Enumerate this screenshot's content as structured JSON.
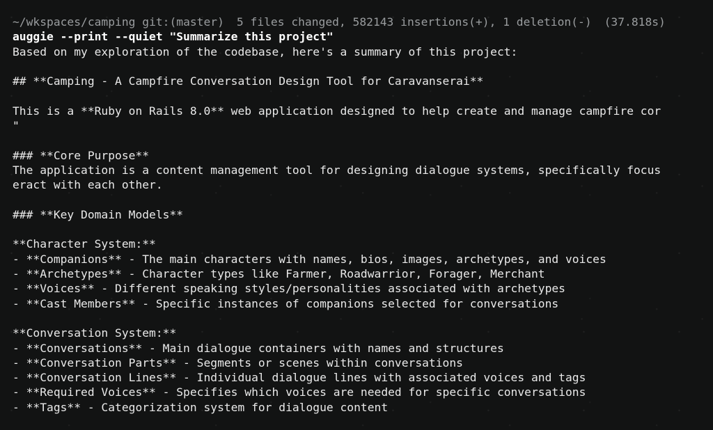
{
  "status_bar": {
    "path": "~/wkspaces/camping",
    "git": "git:(master)",
    "changes": "5 files changed, 582143 insertions(+), 1 deletion(-)",
    "duration": "(37.818s)"
  },
  "command": "auggie --print --quiet \"Summarize this project\"",
  "output_lines": [
    "Based on my exploration of the codebase, here's a summary of this project:",
    "",
    "## **Camping - A Campfire Conversation Design Tool for Caravanserai**",
    "",
    "This is a **Ruby on Rails 8.0** web application designed to help create and manage campfire cor",
    "\"",
    "",
    "### **Core Purpose**",
    "The application is a content management tool for designing dialogue systems, specifically focus",
    "eract with each other.",
    "",
    "### **Key Domain Models**",
    "",
    "**Character System:**",
    "- **Companions** - The main characters with names, bios, images, archetypes, and voices",
    "- **Archetypes** - Character types like Farmer, Roadwarrior, Forager, Merchant",
    "- **Voices** - Different speaking styles/personalities associated with archetypes",
    "- **Cast Members** - Specific instances of companions selected for conversations",
    "",
    "**Conversation System:**",
    "- **Conversations** - Main dialogue containers with names and structures",
    "- **Conversation Parts** - Segments or scenes within conversations",
    "- **Conversation Lines** - Individual dialogue lines with associated voices and tags",
    "- **Required Voices** - Specifies which voices are needed for specific conversations",
    "- **Tags** - Categorization system for dialogue content"
  ]
}
